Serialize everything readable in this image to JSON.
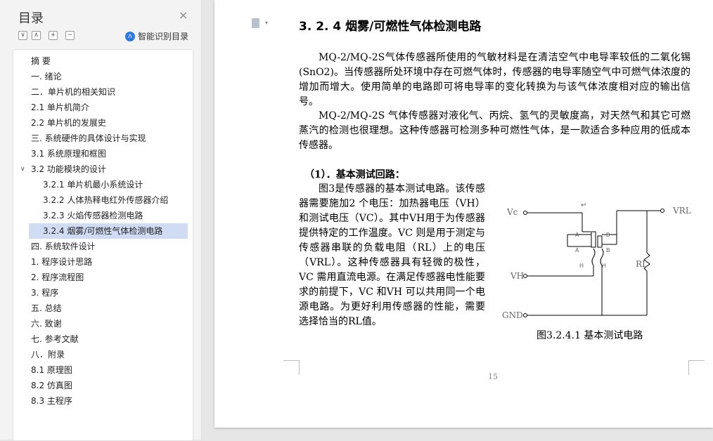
{
  "sidebar": {
    "title": "目录",
    "close_glyph": "×",
    "ai_label": "智能识别目录",
    "ai_icon_glyph": "ᐱ",
    "tools": [
      {
        "name": "collapse-all-icon",
        "glyph": "∨"
      },
      {
        "name": "expand-all-icon",
        "glyph": "∧"
      },
      {
        "name": "add-heading-icon",
        "glyph": "+"
      },
      {
        "name": "remove-heading-icon",
        "glyph": "−"
      }
    ],
    "toc": [
      {
        "label": "摘  要",
        "level": 1
      },
      {
        "label": "一. 绪论",
        "level": 1
      },
      {
        "label": "二．单片机的相关知识",
        "level": 1
      },
      {
        "label": "2.1 单片机简介",
        "level": 1
      },
      {
        "label": "2.2 单片机的发展史",
        "level": 1
      },
      {
        "label": "三. 系统硬件的具体设计与实现",
        "level": 1
      },
      {
        "label": "3.1  系统原理和框图",
        "level": 1
      },
      {
        "label": "3.2  功能模块的设计",
        "level": 1,
        "expanded": true
      },
      {
        "label": "3.2.1 单片机最小系统设计",
        "level": 2
      },
      {
        "label": "3.2.2  人体热释电红外传感器介绍",
        "level": 2
      },
      {
        "label": "3.2.3 火焰传感器检测电路",
        "level": 2
      },
      {
        "label": "3.2.4 烟雾/可燃性气体检测电路",
        "level": 2,
        "selected": true
      },
      {
        "label": "四. 系统软件设计",
        "level": 1
      },
      {
        "label": "1. 程序设计思路",
        "level": 1
      },
      {
        "label": "2. 程序流程图",
        "level": 1
      },
      {
        "label": "3. 程序",
        "level": 1
      },
      {
        "label": "五. 总结",
        "level": 1
      },
      {
        "label": "六. 致谢",
        "level": 1
      },
      {
        "label": "七. 参考文献",
        "level": 1
      },
      {
        "label": "八．附录",
        "level": 1
      },
      {
        "label": "8.1 原理图",
        "level": 1
      },
      {
        "label": "8.2 仿真图",
        "level": 1
      },
      {
        "label": "8.3 主程序",
        "level": 1
      }
    ]
  },
  "doc": {
    "heading": "3. 2. 4 烟雾/可燃性气体检测电路",
    "para1": "MQ-2/MQ-2S气体传感器所使用的气敏材料是在清洁空气中电导率较低的二氧化锡(SnO2)。当传感器所处环境中存在可燃气体时，传感器的电导率随空气中可燃气体浓度的增加而增大。使用简单的电路即可将电导率的变化转换为与该气体浓度相对应的输出信号。",
    "para2": "MQ-2/MQ-2S 气体传感器对液化气、丙烷、氢气的灵敏度高，对天然气和其它可燃蒸汽的检测也很理想。这种传感器可检测多种可燃性气体，是一款适合多种应用的低成本传感器。",
    "sub_heading": "（1）．基本测试回路：",
    "para3": "图3是传感器的基本测试电路。该传感器需要施加2  个电压：加热器电压（VH）和测试电压（VC）。其中VH用于为传感器提供特定的工作温度。VC 则是用于测定与传感器串联的负载电阻（RL）上的电压（VRL）。这种传感器具有轻微的极性，VC 需用直流电源。在满足传感器电性能要求的前提下，VC 和VH  可以共用同一个电源电路。为更好利用传感器的性能，需要选择恰当的RL值。",
    "caption": "图3.2.4.1  基本测试电路",
    "page_number": "15",
    "para_mark": "↵",
    "circuit": {
      "vc": "Vc",
      "vh": "VH",
      "gnd": "GND",
      "vrl": "VRL",
      "rl": "RL",
      "pin_a": "A",
      "pin_b": "B",
      "pin_h": "H"
    }
  }
}
